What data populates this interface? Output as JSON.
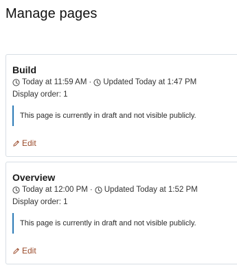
{
  "page": {
    "title": "Manage pages"
  },
  "colors": {
    "accent_border": "#2b7ab6",
    "edit_link": "#9a4a2a",
    "card_border": "#d7dee4"
  },
  "pages": [
    {
      "title": "Build",
      "created": "Today at 11:59 AM",
      "separator": "·",
      "updated": "Updated Today at 1:47 PM",
      "display_order": "Display order: 1",
      "notice": "This page is currently in draft and not visible publicly.",
      "edit_label": "Edit",
      "icons": {
        "created": "clock-icon",
        "updated": "clock-icon",
        "edit": "pencil-icon"
      }
    },
    {
      "title": "Overview",
      "created": "Today at 12:00 PM",
      "separator": "·",
      "updated": "Updated Today at 1:52 PM",
      "display_order": "Display order: 1",
      "notice": "This page is currently in draft and not visible publicly.",
      "edit_label": "Edit",
      "icons": {
        "created": "clock-icon",
        "updated": "clock-icon",
        "edit": "pencil-icon"
      }
    }
  ]
}
